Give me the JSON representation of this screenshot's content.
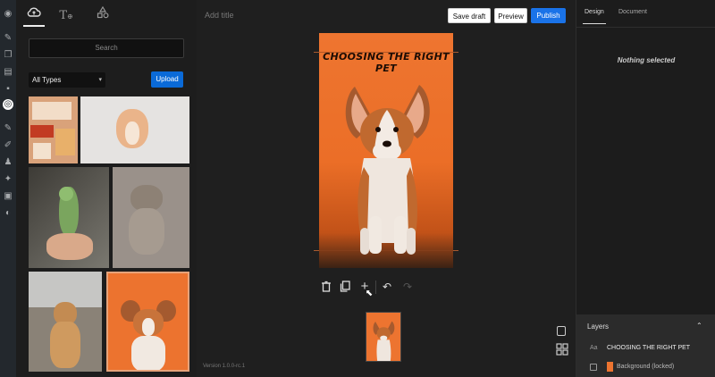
{
  "admin_bar": {
    "icons": [
      "dashboard-icon",
      "pin-icon",
      "stories-icon",
      "pages-icon",
      "comments-icon",
      "web-stories-icon",
      "pin-icon",
      "brush-icon",
      "users-icon",
      "tools-icon",
      "settings-icon",
      "collapse-icon"
    ]
  },
  "library": {
    "tabs": [
      "media-icon",
      "text-icon",
      "shapes-icon"
    ],
    "search_placeholder": "Search",
    "type_filter": "All Types",
    "upload_label": "Upload"
  },
  "editor": {
    "title_placeholder": "Add title",
    "save_draft": "Save draft",
    "preview": "Preview",
    "publish": "Publish",
    "canvas_title": "CHOOSING THE RIGHT PET",
    "version": "Version 1.0.0-rc.1",
    "toolbar": [
      "delete-icon",
      "duplicate-icon",
      "add-page-icon",
      "undo-icon",
      "redo-icon"
    ]
  },
  "right_panel": {
    "tab_design": "Design",
    "tab_document": "Document",
    "empty_state": "Nothing selected",
    "layers_heading": "Layers",
    "layers": [
      {
        "type_label": "Aa",
        "name": "CHOOSING THE RIGHT PET"
      },
      {
        "type_label": "",
        "name": "Background (locked)"
      }
    ]
  },
  "colors": {
    "accent": "#1a73e8",
    "canvas_bg": "#ed7430",
    "panel_bg": "#1d1d1d"
  }
}
